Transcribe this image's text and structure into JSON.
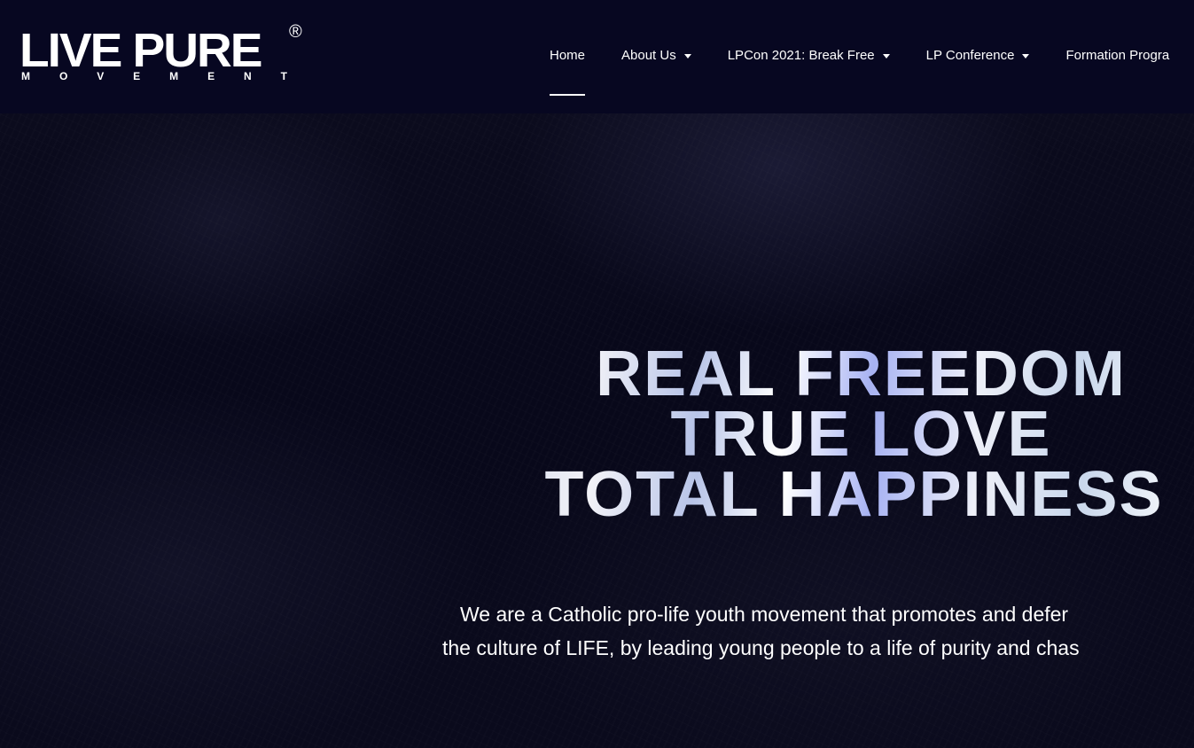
{
  "header": {
    "logo": {
      "main": "LIVE PURE",
      "registered": "®",
      "sub_letters": [
        "M",
        "O",
        "V",
        "E",
        "M",
        "E",
        "N",
        "T"
      ]
    },
    "nav": [
      {
        "label": "Home",
        "active": true,
        "has_dropdown": false
      },
      {
        "label": "About Us",
        "active": false,
        "has_dropdown": true
      },
      {
        "label": "LPCon 2021: Break Free",
        "active": false,
        "has_dropdown": true
      },
      {
        "label": "LP Conference",
        "active": false,
        "has_dropdown": true
      },
      {
        "label": "Formation Progra",
        "active": false,
        "has_dropdown": false
      }
    ]
  },
  "hero": {
    "headline": [
      "REAL FREEDOM",
      "TRUE LOVE",
      "TOTAL HAPPINESS"
    ],
    "intro": [
      "We are a Catholic pro-life youth movement that promotes and defer",
      "the culture of LIFE, by leading young people to a life of purity and chas"
    ]
  },
  "colors": {
    "header_bg": "#070721",
    "hero_bg": "#0a0a1c",
    "text": "#ffffff"
  }
}
